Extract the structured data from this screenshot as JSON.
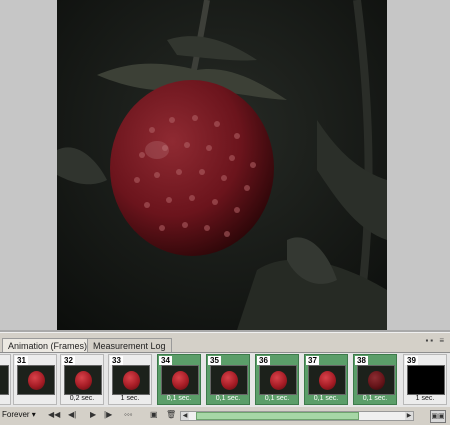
{
  "panel": {
    "tabs": [
      {
        "label": "Animation (Frames)",
        "close": "×"
      },
      {
        "label": "Measurement Log"
      }
    ],
    "menu_glyphs": "▪▪ ≡"
  },
  "frames": [
    {
      "number": "",
      "delay": "",
      "selected": false,
      "dim": false
    },
    {
      "number": "31",
      "delay": "",
      "selected": false,
      "dim": false
    },
    {
      "number": "32",
      "delay": "0,2 sec.",
      "selected": false,
      "dim": false
    },
    {
      "number": "33",
      "delay": "1 sec.",
      "selected": false,
      "dim": false
    },
    {
      "number": "34",
      "delay": "0,1 sec.",
      "selected": true,
      "dim": false
    },
    {
      "number": "35",
      "delay": "0,1 sec.",
      "selected": true,
      "dim": false
    },
    {
      "number": "36",
      "delay": "0,1 sec.",
      "selected": true,
      "dim": false
    },
    {
      "number": "37",
      "delay": "0,1 sec.",
      "selected": true,
      "dim": false
    },
    {
      "number": "38",
      "delay": "0,1 sec.",
      "selected": true,
      "dim": true
    },
    {
      "number": "39",
      "delay": "1 sec.",
      "selected": false,
      "dim": false,
      "black": true
    }
  ],
  "controls": {
    "loop": "Forever ▾",
    "first": "◀◀",
    "prev": "◀|",
    "play": "▶",
    "next": "|▶",
    "tween": "◦◦◦",
    "new": "▣",
    "delete": "🗑",
    "scroll_left": "◀",
    "scroll_right": "▶",
    "corner": "▣▣",
    "left_stub": "▾"
  },
  "scroll": {
    "position": 0.03,
    "visible_fraction": 0.75
  }
}
